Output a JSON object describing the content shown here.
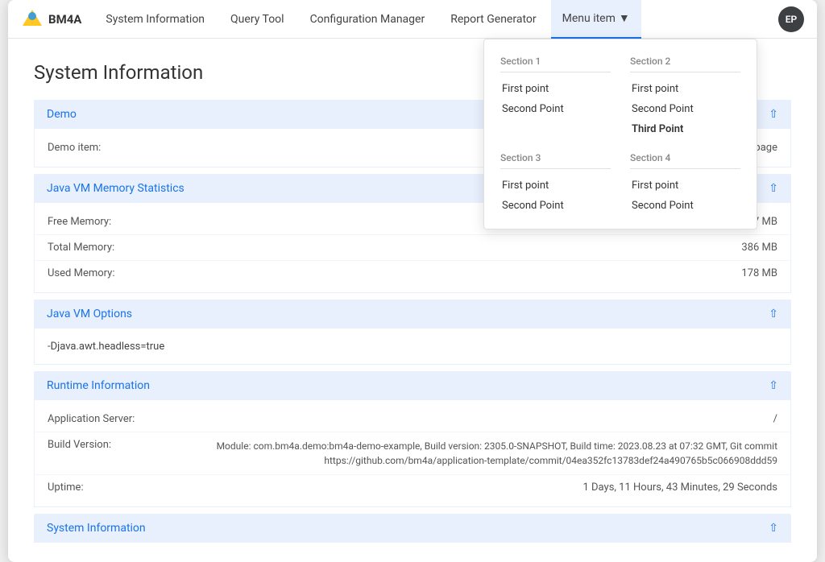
{
  "app": {
    "logo_text": "BM4A"
  },
  "navbar": {
    "items": [
      {
        "label": "System Information",
        "id": "system-information"
      },
      {
        "label": "Query Tool",
        "id": "query-tool"
      },
      {
        "label": "Configuration Manager",
        "id": "configuration-manager"
      },
      {
        "label": "Report Generator",
        "id": "report-generator"
      }
    ],
    "menu_item_label": "Menu item",
    "avatar_initials": "EP"
  },
  "dropdown": {
    "section1_title": "Section 1",
    "section1_items": [
      "First point",
      "Second Point"
    ],
    "section2_title": "Section 2",
    "section2_items": [
      "First point",
      "Second Point",
      "Third Point"
    ],
    "section3_title": "Section 3",
    "section3_items": [
      "First point",
      "Second Point"
    ],
    "section4_title": "Section 4",
    "section4_items": [
      "First point",
      "Second Point"
    ]
  },
  "page": {
    "title": "System Information"
  },
  "sections": [
    {
      "id": "demo",
      "header": "Demo",
      "rows": [
        {
          "label": "Demo item:",
          "value": "demo page",
          "align": "right"
        }
      ]
    },
    {
      "id": "java-vm-memory",
      "header": "Java VM Memory Statistics",
      "rows": [
        {
          "label": "Free Memory:",
          "value": "207 MB",
          "align": "right"
        },
        {
          "label": "Total Memory:",
          "value": "386 MB",
          "align": "right"
        },
        {
          "label": "Used Memory:",
          "value": "178 MB",
          "align": "right"
        }
      ]
    },
    {
      "id": "java-vm-options",
      "header": "Java VM Options",
      "jvm_text": "-Djava.awt.headless=true"
    },
    {
      "id": "runtime",
      "header": "Runtime Information",
      "rows": [
        {
          "label": "Application Server:",
          "value": "/",
          "align": "right"
        },
        {
          "label": "Build Version:",
          "value": "Module: com.bm4a.demo:bm4a-demo-example, Build version: 2305.0-SNAPSHOT, Build time: 2023.08.23 at 07:32 GMT, Git commit https://github.com/bm4a/application-template/commit/04ea352fc13783def24a490765b5c066908ddd59",
          "align": "right",
          "multiline": true
        },
        {
          "label": "Uptime:",
          "value": "1 Days, 11 Hours, 43 Minutes, 29 Seconds",
          "align": "right"
        }
      ]
    },
    {
      "id": "system-info",
      "header": "System Information"
    }
  ]
}
